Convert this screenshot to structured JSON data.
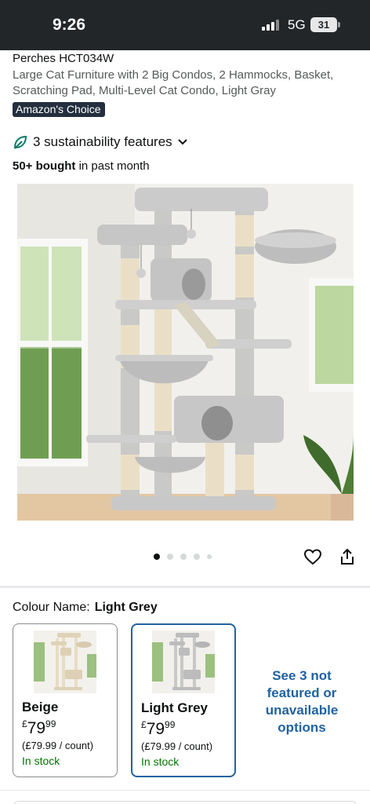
{
  "status_bar": {
    "time": "9:26",
    "network": "5G",
    "battery": "31"
  },
  "product": {
    "brand_line": "Perches HCT034W",
    "title": "Large Cat Furniture with 2 Big Condos, 2 Hammocks, Basket, Scratching Pad, Multi-Level Cat Condo, Light Gray",
    "badge": "Amazon's Choice",
    "sustainability": "3 sustainability features",
    "bought_bold": "50+ bought",
    "bought_rest": " in past month",
    "image_icon": "cat-tree-product-photo",
    "carousel": {
      "count": 5,
      "active_index": 0
    }
  },
  "colour": {
    "label": "Colour Name:",
    "selected": "Light Grey",
    "options": [
      {
        "name": "Beige",
        "currency": "£",
        "price_whole": "79",
        "price_fraction": "99",
        "unit_price": "(£79.99 / count)",
        "stock": "In stock",
        "selected": false
      },
      {
        "name": "Light Grey",
        "currency": "£",
        "price_whole": "79",
        "price_fraction": "99",
        "unit_price": "(£79.99 / count)",
        "stock": "In stock",
        "selected": true
      }
    ],
    "more_options": "See 3 not featured or unavailable options"
  },
  "colors": {
    "accent_blue": "#2162a1",
    "in_stock_green": "#007600",
    "badge_bg": "#232f3e",
    "status_bar_bg": "#232629"
  },
  "icons": {
    "sustain": "leaf-icon",
    "expand": "chevron-down-icon",
    "wishlist": "heart-icon",
    "share": "share-icon"
  }
}
